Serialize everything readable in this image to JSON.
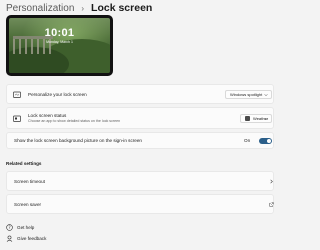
{
  "breadcrumb": {
    "parent": "Personalization",
    "separator": "›",
    "current": "Lock screen"
  },
  "preview": {
    "time": "10:01",
    "date": "Monday, March 1"
  },
  "settings": {
    "personalize": {
      "label": "Personalize your lock screen",
      "value": "Windows spotlight"
    },
    "status": {
      "label": "Lock screen status",
      "description": "Choose an app to show detailed status on the lock screen",
      "value": "Weather"
    },
    "signin_background": {
      "label": "Show the lock screen background picture on the sign-in screen",
      "state": "On",
      "on": true
    }
  },
  "related": {
    "title": "Related settings",
    "screen_timeout": "Screen timeout",
    "screen_saver": "Screen saver"
  },
  "footer": {
    "get_help": "Get help",
    "give_feedback": "Give feedback"
  },
  "colors": {
    "accent": "#2b5f8a",
    "background": "#f3f3f3",
    "card": "#fbfbfb"
  }
}
